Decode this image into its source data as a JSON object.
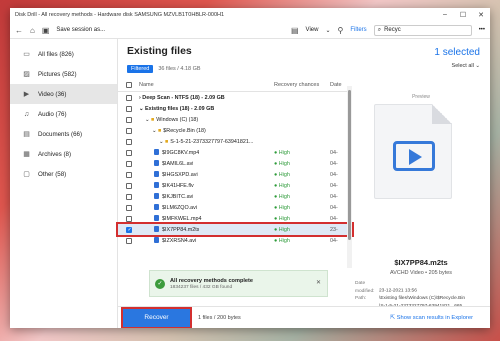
{
  "window": {
    "title": "Disk Drill - All recovery methods - Hardware disk SAMSUNG MZVLB1T0HBLR-000H1"
  },
  "toolbar": {
    "save_label": "Save session as...",
    "view_label": "View",
    "filters_label": "Filters",
    "search_value": "Recyc"
  },
  "sidebar": {
    "items": [
      {
        "label": "All files (826)",
        "icon": "file-icon"
      },
      {
        "label": "Pictures (582)",
        "icon": "image-icon"
      },
      {
        "label": "Video (36)",
        "icon": "video-icon"
      },
      {
        "label": "Audio (76)",
        "icon": "music-icon"
      },
      {
        "label": "Documents (66)",
        "icon": "document-icon"
      },
      {
        "label": "Archives (8)",
        "icon": "archive-icon"
      },
      {
        "label": "Other (58)",
        "icon": "other-icon"
      }
    ]
  },
  "main": {
    "title": "Existing files",
    "filtered_chip": "Filtered",
    "count_text": "36 files / 4.18 GB",
    "columns": {
      "name": "Name",
      "recovery": "Recovery chances",
      "date": "Date"
    },
    "rows": [
      {
        "name": "Deep Scan - NTFS (18) - 2.09 GB",
        "rec": "",
        "date": ""
      },
      {
        "name": "Existing files (18) - 2.09 GB",
        "rec": "",
        "date": ""
      },
      {
        "name": "Windows (C) (18)",
        "rec": "",
        "date": ""
      },
      {
        "name": "$Recycle.Bin (18)",
        "rec": "",
        "date": ""
      },
      {
        "name": "S-1-5-21-2373327797-63941821...",
        "rec": "",
        "date": ""
      },
      {
        "name": "$I9GC8KV.mp4",
        "rec": "High",
        "date": "04-"
      },
      {
        "name": "$IAMIL6L.avi",
        "rec": "High",
        "date": "04-"
      },
      {
        "name": "$IHGSXPD.avi",
        "rec": "High",
        "date": "04-"
      },
      {
        "name": "$IK41HFE.flv",
        "rec": "High",
        "date": "04-"
      },
      {
        "name": "$IKJBITC.avi",
        "rec": "High",
        "date": "04-"
      },
      {
        "name": "$ILM6ZQO.avi",
        "rec": "High",
        "date": "04-"
      },
      {
        "name": "$IMFKWEL.mp4",
        "rec": "High",
        "date": "04-"
      },
      {
        "name": "$IX7PP84.m2ts",
        "rec": "High",
        "date": "23-"
      },
      {
        "name": "$IZXRSN4.avi",
        "rec": "High",
        "date": "04-"
      }
    ],
    "toast": {
      "title": "All recovery methods complete",
      "subtitle": "1834237 files / 432 GB found"
    }
  },
  "preview": {
    "selected": "1 selected",
    "select_all": "Select all",
    "label": "Preview",
    "file_name": "$IX7PP84.m2ts",
    "file_type": "AVCHD Video • 205 bytes",
    "date_key": "Date modified:",
    "date_val": "23-12-2021 13:56",
    "path_key": "Path:",
    "path_val1": "\\Existing files\\Windows (C)\\$Recycle.Bin",
    "path_val2": "\\S-1-5-21-2373327797-63941821...665..."
  },
  "footer": {
    "recover_label": "Recover",
    "info": "1 files / 200 bytes",
    "show_results": "Show scan results in Explorer"
  }
}
